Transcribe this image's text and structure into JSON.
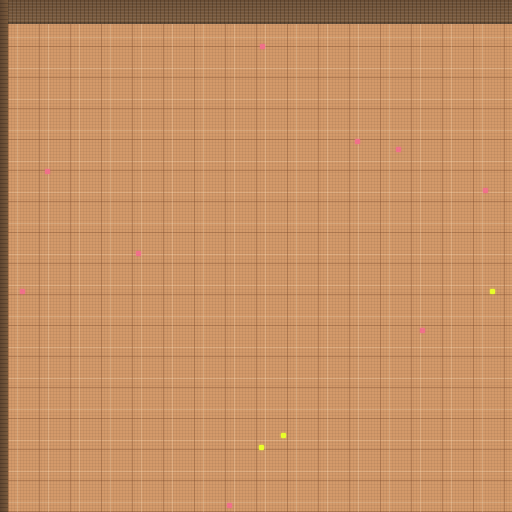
{
  "scene": {
    "floor_pattern": "plaid-carpet",
    "colors": {
      "floor": "#d49a6a",
      "wall": "#7a5a3c",
      "pink_entity": "#f0708a",
      "yellow_entity": "#e8ff2a"
    },
    "entities": [
      {
        "id": "e1",
        "kind": "pink-pellet"
      },
      {
        "id": "e2",
        "kind": "pink-pellet"
      },
      {
        "id": "e3",
        "kind": "pink-pellet"
      },
      {
        "id": "e4",
        "kind": "pink-pellet"
      },
      {
        "id": "e5",
        "kind": "pink-pellet"
      },
      {
        "id": "e6",
        "kind": "pink-pellet"
      },
      {
        "id": "e7",
        "kind": "pink-pellet"
      },
      {
        "id": "e8",
        "kind": "yellow-agent"
      },
      {
        "id": "e9",
        "kind": "pink-pellet"
      },
      {
        "id": "e10",
        "kind": "yellow-agent"
      },
      {
        "id": "e11",
        "kind": "yellow-agent"
      },
      {
        "id": "e12",
        "kind": "pink-pellet"
      }
    ]
  }
}
